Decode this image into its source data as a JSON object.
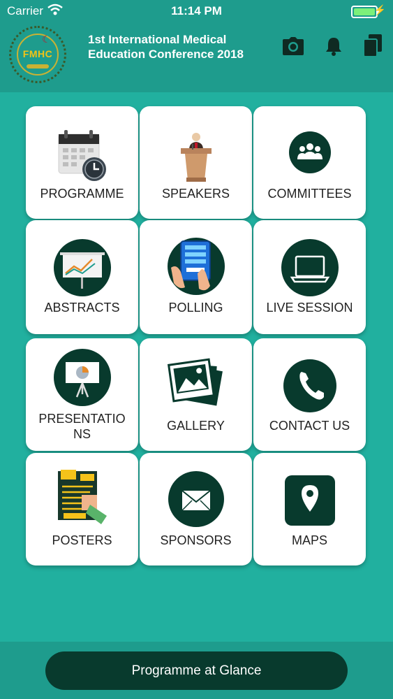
{
  "status": {
    "carrier": "Carrier",
    "time": "11:14 PM"
  },
  "header": {
    "logo_text": "FMHC",
    "title_line1": "1st International Medical",
    "title_line2": "Education Conference 2018",
    "icons": [
      "camera-icon",
      "bell-icon",
      "documents-icon"
    ]
  },
  "menu": [
    {
      "label": "PROGRAMME",
      "icon": "calendar-clock-icon"
    },
    {
      "label": "SPEAKERS",
      "icon": "podium-icon"
    },
    {
      "label": "COMMITTEES",
      "icon": "group-icon"
    },
    {
      "label": "ABSTRACTS",
      "icon": "presentation-chart-icon"
    },
    {
      "label": "POLLING",
      "icon": "tablet-vote-icon"
    },
    {
      "label": "LIVE SESSION",
      "icon": "laptop-icon"
    },
    {
      "label": "PRESENTATIO",
      "label2": "NS",
      "icon": "easel-pie-icon"
    },
    {
      "label": "GALLERY",
      "icon": "photos-icon"
    },
    {
      "label": "CONTACT US",
      "icon": "phone-icon"
    },
    {
      "label": "POSTERS",
      "icon": "poster-icon"
    },
    {
      "label": "SPONSORS",
      "icon": "envelope-icon"
    },
    {
      "label": "MAPS",
      "icon": "map-pin-icon"
    }
  ],
  "footer": {
    "button_label": "Programme at Glance"
  },
  "colors": {
    "background": "#21b09f",
    "header": "#1e9c8d",
    "dark_green": "#083a2d",
    "tile": "#ffffff"
  }
}
